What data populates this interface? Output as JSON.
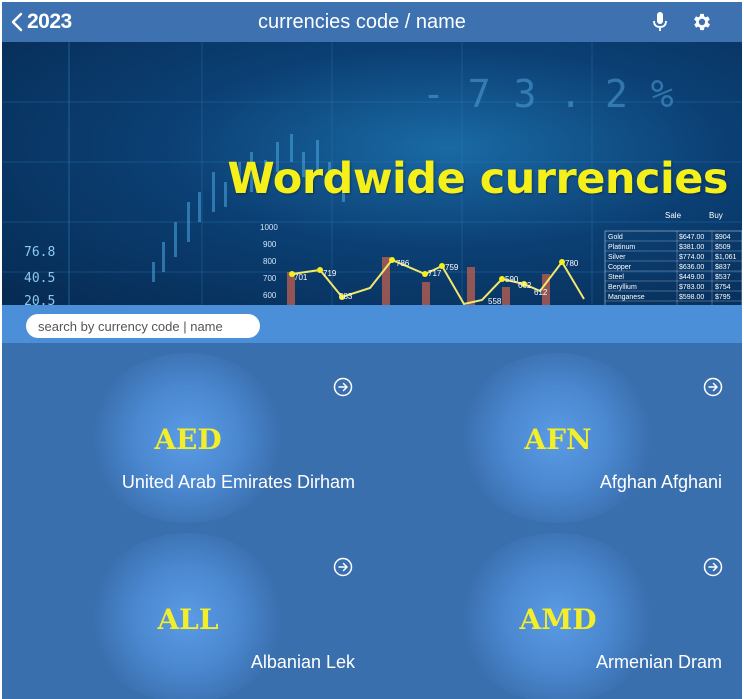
{
  "header": {
    "back_label": "2023",
    "title": "currencies code / name",
    "icons": [
      "chevron-left-icon",
      "microphone-icon",
      "gear-icon"
    ]
  },
  "banner": {
    "headline": "Wordwide currencies",
    "left_axis_labels": [
      "76.8",
      "40.5",
      "20.5"
    ],
    "chart_axis_labels": [
      "1000",
      "900",
      "800",
      "700",
      "600"
    ],
    "price_labels": [
      "701",
      "719",
      "583",
      "786",
      "717",
      "759",
      "590",
      "662",
      "612",
      "780",
      "558"
    ],
    "digits": "- 7 3 . 2 %",
    "table_headers": [
      "Sale",
      "Buy"
    ],
    "table_rows": [
      [
        "Gold",
        "$647.00",
        "$904"
      ],
      [
        "Platinum",
        "$381.00",
        "$509"
      ],
      [
        "Silver",
        "$774.00",
        "$1,061"
      ],
      [
        "Copper",
        "$636.00",
        "$837"
      ],
      [
        "Steel",
        "$449.00",
        "$537"
      ],
      [
        "Beryllium",
        "$783.00",
        "$754"
      ],
      [
        "Manganese",
        "$598.00",
        "$795"
      ]
    ]
  },
  "search": {
    "placeholder": "search by currency code | name"
  },
  "currencies": [
    {
      "code": "AED",
      "name": "United Arab Emirates Dirham"
    },
    {
      "code": "AFN",
      "name": "Afghan Afghani"
    },
    {
      "code": "ALL",
      "name": "Albanian Lek"
    },
    {
      "code": "AMD",
      "name": "Armenian Dram"
    }
  ],
  "colors": {
    "header_bg": "#3d71b0",
    "accent_yellow": "#f6f01a",
    "search_strip": "#4a8fd8",
    "grid_bg": "#3a6fae"
  }
}
